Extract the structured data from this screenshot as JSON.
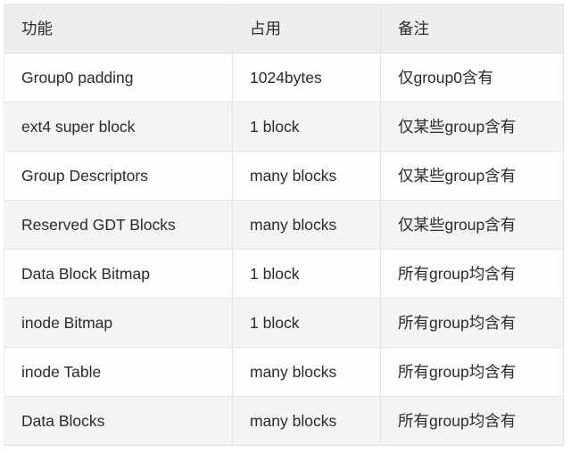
{
  "table": {
    "columns": [
      {
        "key": "feature",
        "label": "功能"
      },
      {
        "key": "usage",
        "label": "占用"
      },
      {
        "key": "note",
        "label": "备注"
      }
    ],
    "rows": [
      {
        "feature": "Group0 padding",
        "usage": "1024bytes",
        "note": "仅group0含有"
      },
      {
        "feature": "ext4 super block",
        "usage": "1 block",
        "note": "仅某些group含有"
      },
      {
        "feature": "Group Descriptors",
        "usage": "many blocks",
        "note": "仅某些group含有"
      },
      {
        "feature": "Reserved GDT Blocks",
        "usage": "many blocks",
        "note": "仅某些group含有"
      },
      {
        "feature": "Data Block Bitmap",
        "usage": "1 block",
        "note": "所有group均含有"
      },
      {
        "feature": "inode Bitmap",
        "usage": "1 block",
        "note": "所有group均含有"
      },
      {
        "feature": "inode Table",
        "usage": "many blocks",
        "note": "所有group均含有"
      },
      {
        "feature": "Data Blocks",
        "usage": "many blocks",
        "note": "所有group均含有"
      }
    ]
  },
  "colors": {
    "header_bg": "#eeeeee",
    "row_odd_bg": "#fdfdfd",
    "row_even_bg": "#f4f4f5",
    "border": "#e3e3e5",
    "text": "#2b2b2b",
    "page_bg": "#ffffff"
  }
}
